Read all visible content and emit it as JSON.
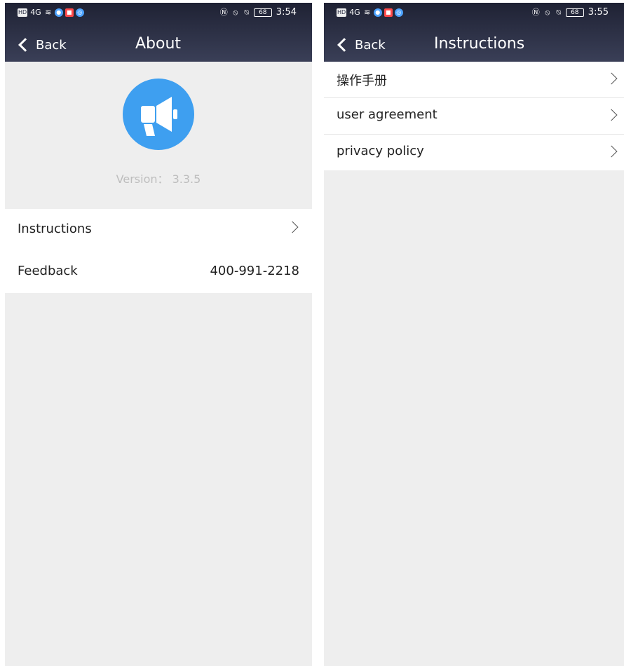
{
  "screens": {
    "about": {
      "status": {
        "time": "3:54",
        "battery": "68",
        "network": "4G"
      },
      "nav": {
        "back_label": "Back",
        "title": "About"
      },
      "version_text": "Version： 3.3.5",
      "menu": [
        {
          "label": "Instructions"
        },
        {
          "label": "Feedback",
          "value": "400-991-2218"
        }
      ]
    },
    "instructions": {
      "status": {
        "time": "3:55",
        "battery": "68",
        "network": "4G"
      },
      "nav": {
        "back_label": "Back",
        "title": "Instructions"
      },
      "items": [
        {
          "label": "操作手册"
        },
        {
          "label": "user agreement"
        },
        {
          "label": "privacy policy"
        }
      ]
    }
  },
  "colors": {
    "header_top": "#1f2234",
    "header_bottom": "#3a3f57",
    "logo_blue": "#3e9ff0",
    "page_background": "#eeeeee"
  },
  "icons": {
    "app_logo": "megaphone-icon",
    "back": "chevron-left-icon",
    "row_arrow": "chevron-right-icon"
  }
}
